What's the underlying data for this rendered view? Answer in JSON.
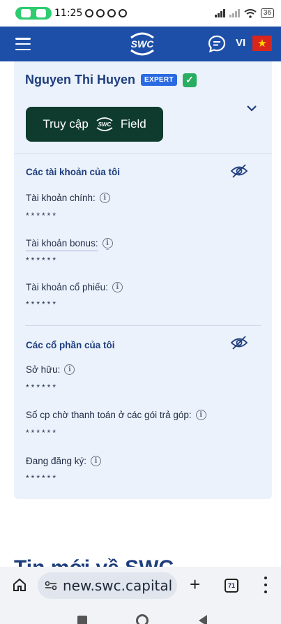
{
  "status_bar": {
    "time": "11:25",
    "battery": "36"
  },
  "header": {
    "logo_text": "SWC",
    "language": "VI",
    "flag_star": "★"
  },
  "profile": {
    "name": "Nguyen Thi Huyen",
    "badge": "EXPERT",
    "verified_mark": "✓",
    "field_button": {
      "prefix": "Truy cập",
      "logo": "SWC",
      "suffix": "Field"
    }
  },
  "accounts": {
    "title": "Các tài khoản của tôi",
    "items": [
      {
        "label": "Tài khoản chính:",
        "value": "******"
      },
      {
        "label": "Tài khoản bonus:",
        "value": "******"
      },
      {
        "label": "Tài khoản cổ phiếu:",
        "value": "******"
      }
    ]
  },
  "shares": {
    "title": "Các cổ phần của tôi",
    "items": [
      {
        "label": "Sở hữu:",
        "value": "******"
      },
      {
        "label": "Số cp chờ thanh toán ở các gói trả góp:",
        "value": "******"
      },
      {
        "label": "Đang đăng ký:",
        "value": "******"
      }
    ]
  },
  "peek_heading": "Tin mới về SWC",
  "browser": {
    "url": "new.swc.capital",
    "tab_count": "71"
  },
  "icons": {
    "info": "i"
  },
  "colors": {
    "header_blue": "#1d4fa8",
    "card_bg": "#ebf2fc",
    "field_button": "#0f3b2e",
    "expert_badge": "#2a6ae3",
    "verified": "#27ae60"
  }
}
